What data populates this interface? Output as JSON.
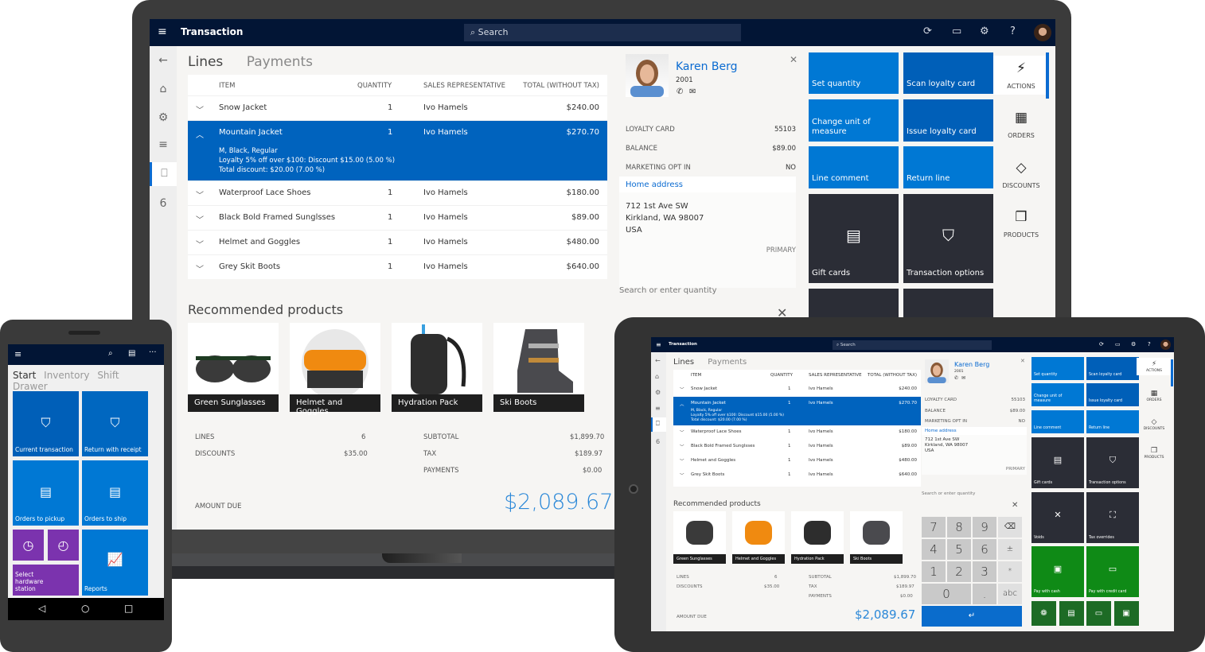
{
  "app": {
    "title": "Transaction",
    "search_placeholder": "Search",
    "icons": [
      "refresh-icon",
      "chat-icon",
      "gear-icon",
      "help-icon",
      "user-avatar"
    ]
  },
  "leftnav": {
    "items": [
      {
        "name": "back-icon",
        "glyph": "←"
      },
      {
        "name": "home-icon",
        "glyph": "⌂"
      },
      {
        "name": "products-icon",
        "glyph": "⚙"
      },
      {
        "name": "lines-icon",
        "glyph": "≡"
      },
      {
        "name": "bag-icon",
        "glyph": "🛍"
      },
      {
        "name": "count-badge",
        "glyph": "6"
      }
    ]
  },
  "tabs": {
    "lines": "Lines",
    "payments": "Payments"
  },
  "grid": {
    "headers": {
      "item": "ITEM",
      "quantity": "QUANTITY",
      "rep": "SALES REPRESENTATIVE",
      "total": "TOTAL (WITHOUT TAX)"
    },
    "rows": [
      {
        "item": "Snow Jacket",
        "qty": "1",
        "rep": "Ivo Hamels",
        "total": "$240.00"
      },
      {
        "item": "Mountain Jacket",
        "qty": "1",
        "rep": "Ivo Hamels",
        "total": "$270.70",
        "details": [
          "M, Black, Regular",
          "Loyalty 5% off over $100: Discount $15.00 (5.00 %)",
          "Total discount: $20.00 (7.00 %)"
        ]
      },
      {
        "item": "Waterproof Lace Shoes",
        "qty": "1",
        "rep": "Ivo Hamels",
        "total": "$180.00"
      },
      {
        "item": "Black Bold Framed Sunglsses",
        "qty": "1",
        "rep": "Ivo Hamels",
        "total": "$89.00"
      },
      {
        "item": "Helmet and Goggles",
        "qty": "1",
        "rep": "Ivo Hamels",
        "total": "$480.00"
      },
      {
        "item": "Grey Skit Boots",
        "qty": "1",
        "rep": "Ivo Hamels",
        "total": "$640.00"
      }
    ]
  },
  "recommended": {
    "title": "Recommended products",
    "products": [
      "Green Sunglasses",
      "Helmet and Goggles",
      "Hydration Pack",
      "Ski Boots"
    ]
  },
  "summary": {
    "lines_label": "LINES",
    "lines": "6",
    "discounts_label": "DISCOUNTS",
    "discounts": "$35.00",
    "subtotal_label": "SUBTOTAL",
    "subtotal": "$1,899.70",
    "tax_label": "TAX",
    "tax": "$189.97",
    "payments_label": "PAYMENTS",
    "payments": "$0.00",
    "amount_due_label": "AMOUNT DUE",
    "amount_due": "$2,089.67"
  },
  "customer": {
    "name": "Karen Berg",
    "id": "2001",
    "loyalty_label": "LOYALTY CARD",
    "loyalty": "55103",
    "balance_label": "BALANCE",
    "balance": "$89.00",
    "marketing_label": "MARKETING OPT IN",
    "marketing": "NO",
    "address_title": "Home address",
    "address": [
      "712 1st Ave SW",
      "Kirkland, WA 98007",
      "USA"
    ],
    "primary": "PRIMARY",
    "search_qty_placeholder": "Search or enter quantity"
  },
  "tiles": [
    "Set quantity",
    "Scan loyalty card",
    "Change unit of measure",
    "Issue loyalty card",
    "Line comment",
    "Return line",
    "Gift cards",
    "Transaction options",
    "Voids",
    "Tax overrides",
    "Pay with cash",
    "Pay with credit card"
  ],
  "rail": [
    "ACTIONS",
    "ORDERS",
    "DISCOUNTS",
    "PRODUCTS"
  ],
  "phone": {
    "tabs": [
      "Start",
      "Inventory",
      "Shift",
      "Drawer"
    ],
    "tiles": [
      "Current transaction",
      "Return with receipt",
      "Orders to pickup",
      "Orders to ship",
      "Select hardware station",
      "Reports"
    ]
  },
  "keypad": [
    "7",
    "8",
    "9",
    "⌫",
    "4",
    "5",
    "6",
    "±",
    "1",
    "2",
    "3",
    "*",
    "0",
    ".",
    "abc",
    "↵"
  ],
  "colors": {
    "navy": "#021535",
    "accent": "#0078d4",
    "selected_row": "#0063be",
    "amount": "#2b88d8",
    "tile_dark": "#2b2d36",
    "purple": "#7b33ae",
    "green": "#0f8a16"
  }
}
